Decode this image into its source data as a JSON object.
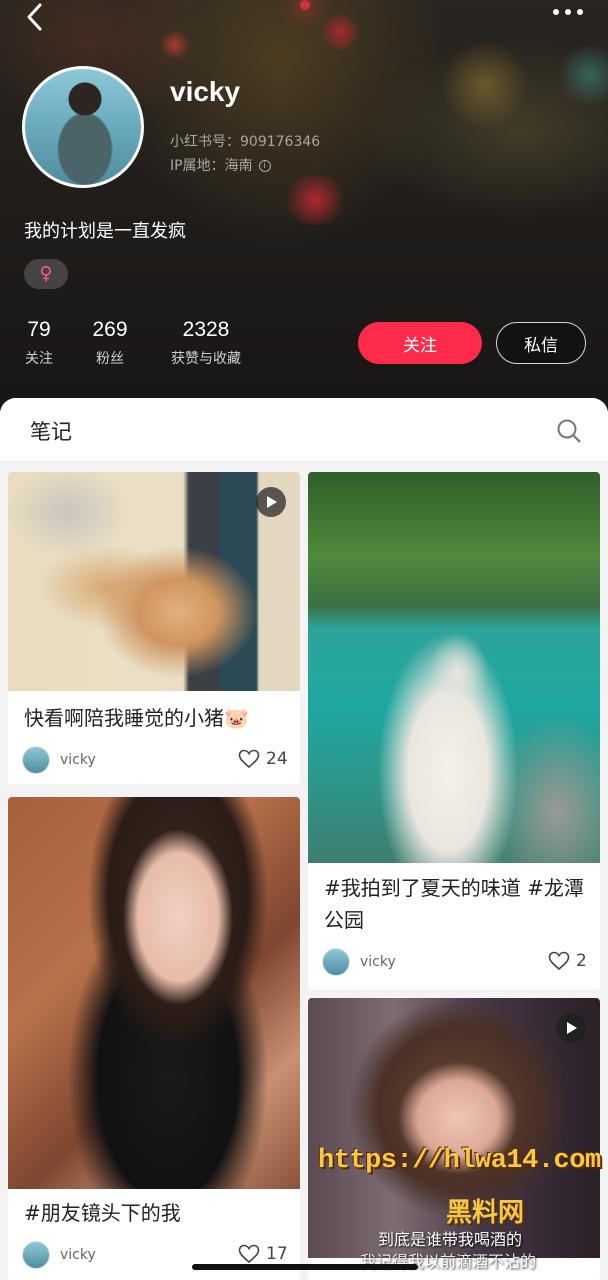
{
  "profile": {
    "username": "vicky",
    "red_id_label": "小红书号：909176346",
    "ip_label": "IP属地：海南",
    "bio": "我的计划是一直发疯",
    "gender_symbol": "♀",
    "stats": [
      {
        "value": "79",
        "label": "关注"
      },
      {
        "value": "269",
        "label": "粉丝"
      },
      {
        "value": "2328",
        "label": "获赞与收藏"
      }
    ],
    "follow_label": "关注",
    "message_label": "私信"
  },
  "notes": {
    "tab_label": "笔记",
    "cards": [
      {
        "title": "快看啊陪我睡觉的小猪🐷",
        "author": "vicky",
        "likes": "24"
      },
      {
        "title": "#我拍到了夏天的味道 #龙潭公园",
        "author": "vicky",
        "likes": "2"
      },
      {
        "title": "#朋友镜头下的我",
        "author": "vicky",
        "likes": "17"
      },
      {
        "title": "",
        "author": "",
        "likes": ""
      }
    ]
  },
  "overlay": {
    "watermark_url": "https://hlwa14.com",
    "watermark_name": "黑料网",
    "video_subtitle_1": "到底是谁带我喝酒的",
    "video_subtitle_2": "我记得我以前滴酒不沾的"
  },
  "colors": {
    "accent": "#fe2c4a",
    "header_bg": "#1f1c1a"
  }
}
